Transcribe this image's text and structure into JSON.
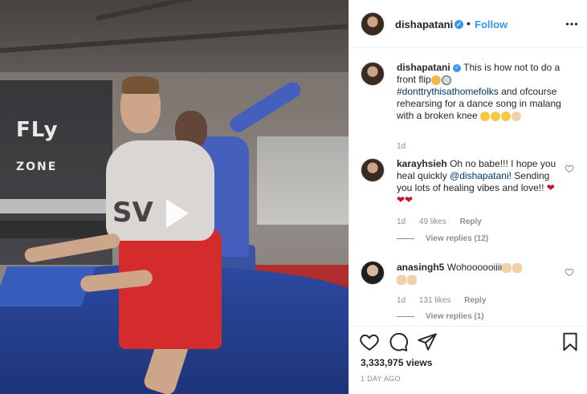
{
  "video": {
    "logo_line1": "FLy",
    "logo_line2": "ZONE",
    "shirt_print": "SV",
    "play_icon": "play-icon"
  },
  "header": {
    "username": "dishapatani",
    "verified": true,
    "follow_label": "Follow",
    "more_icon": "more-options-icon"
  },
  "caption": {
    "username": "dishapatani",
    "text_before": "This is how not to do a front flip",
    "hashtag": "#donttrythisathomefolks",
    "text_after": "and ofcourse rehearsing for a dance song in malang with a broken knee",
    "time": "1d"
  },
  "comments": [
    {
      "username": "karayhsieh",
      "text_before": "Oh no babe!!! I hope you heal quickly",
      "mention": "@dishapatani",
      "text_after": "! Sending you lots of healing vibes and love!!",
      "time": "1d",
      "likes": "49 likes",
      "reply_label": "Reply",
      "view_replies": "View replies (12)"
    },
    {
      "username": "anasingh5",
      "text": "Wohoooooiiii",
      "time": "1d",
      "likes": "131 likes",
      "reply_label": "Reply",
      "view_replies": "View replies (1)"
    }
  ],
  "stats": {
    "views": "3,333,975 views",
    "posted": "1 DAY AGO"
  },
  "colors": {
    "accent_blue": "#3897f0",
    "link_dark": "#00376b",
    "muted": "#8e8e8e",
    "text": "#262626",
    "heart_red": "#ed4956"
  }
}
